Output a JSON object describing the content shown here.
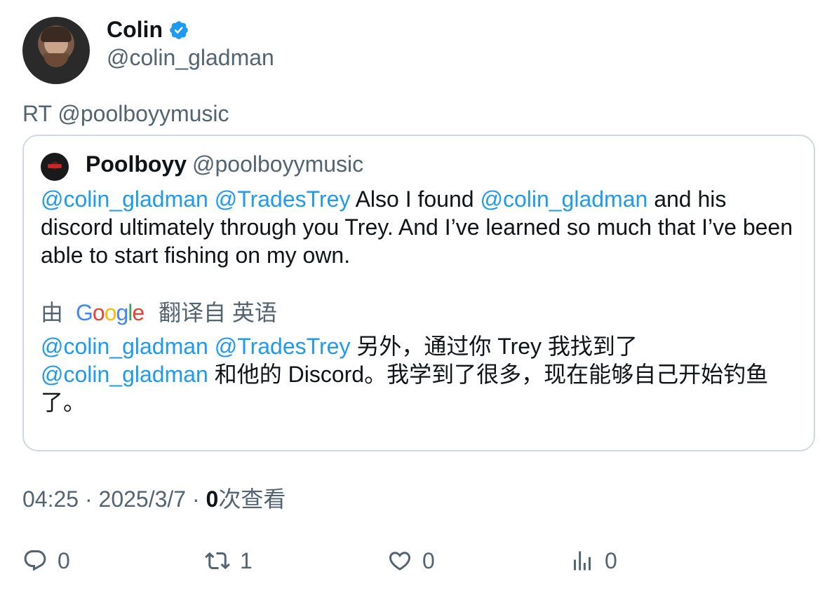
{
  "author": {
    "name": "Colin",
    "handle": "@colin_gladman",
    "verified_color": "#1d9bf0"
  },
  "retweet_text": "RT @poolboyymusic",
  "quoted": {
    "name": "Poolboyy",
    "handle": "@poolboyymusic",
    "body": {
      "m1": "@colin_gladman",
      "m2": "@TradesTrey",
      "t1": " Also I found ",
      "m3": "@colin_gladman",
      "t2": " and his discord ultimately through you Trey. And I’ve learned so much that I’ve been able to start fishing on my own."
    },
    "translation_note": {
      "by": "由",
      "google": [
        "G",
        "o",
        "o",
        "g",
        "l",
        "e"
      ],
      "google_colors": [
        "#4285f4",
        "#ea4335",
        "#fbbc05",
        "#4285f4",
        "#34a853",
        "#ea4335"
      ],
      "from": "翻译自 英语"
    },
    "translation": {
      "m1": "@colin_gladman",
      "m2": "@TradesTrey",
      "t1": " 另外，通过你 Trey 我找到了",
      "m3": "@colin_gladman",
      "t2": " 和他的 Discord。我学到了很多，现在能够自己开始钓鱼了。"
    }
  },
  "meta": {
    "time": "04:25",
    "sep1": " · ",
    "date": "2025/3/7",
    "sep2": " · ",
    "views_count": "0",
    "views_label": "次查看"
  },
  "actions": {
    "replies": {
      "icon": "reply-icon",
      "count": "0"
    },
    "retweets": {
      "icon": "retweet-icon",
      "count": "1"
    },
    "likes": {
      "icon": "heart-icon",
      "count": "0"
    },
    "views": {
      "icon": "analytics-icon",
      "count": "0"
    }
  },
  "colors": {
    "accent": "#1d9bf0",
    "muted": "#536471",
    "text": "#0f1419",
    "border": "#cfd9de"
  }
}
